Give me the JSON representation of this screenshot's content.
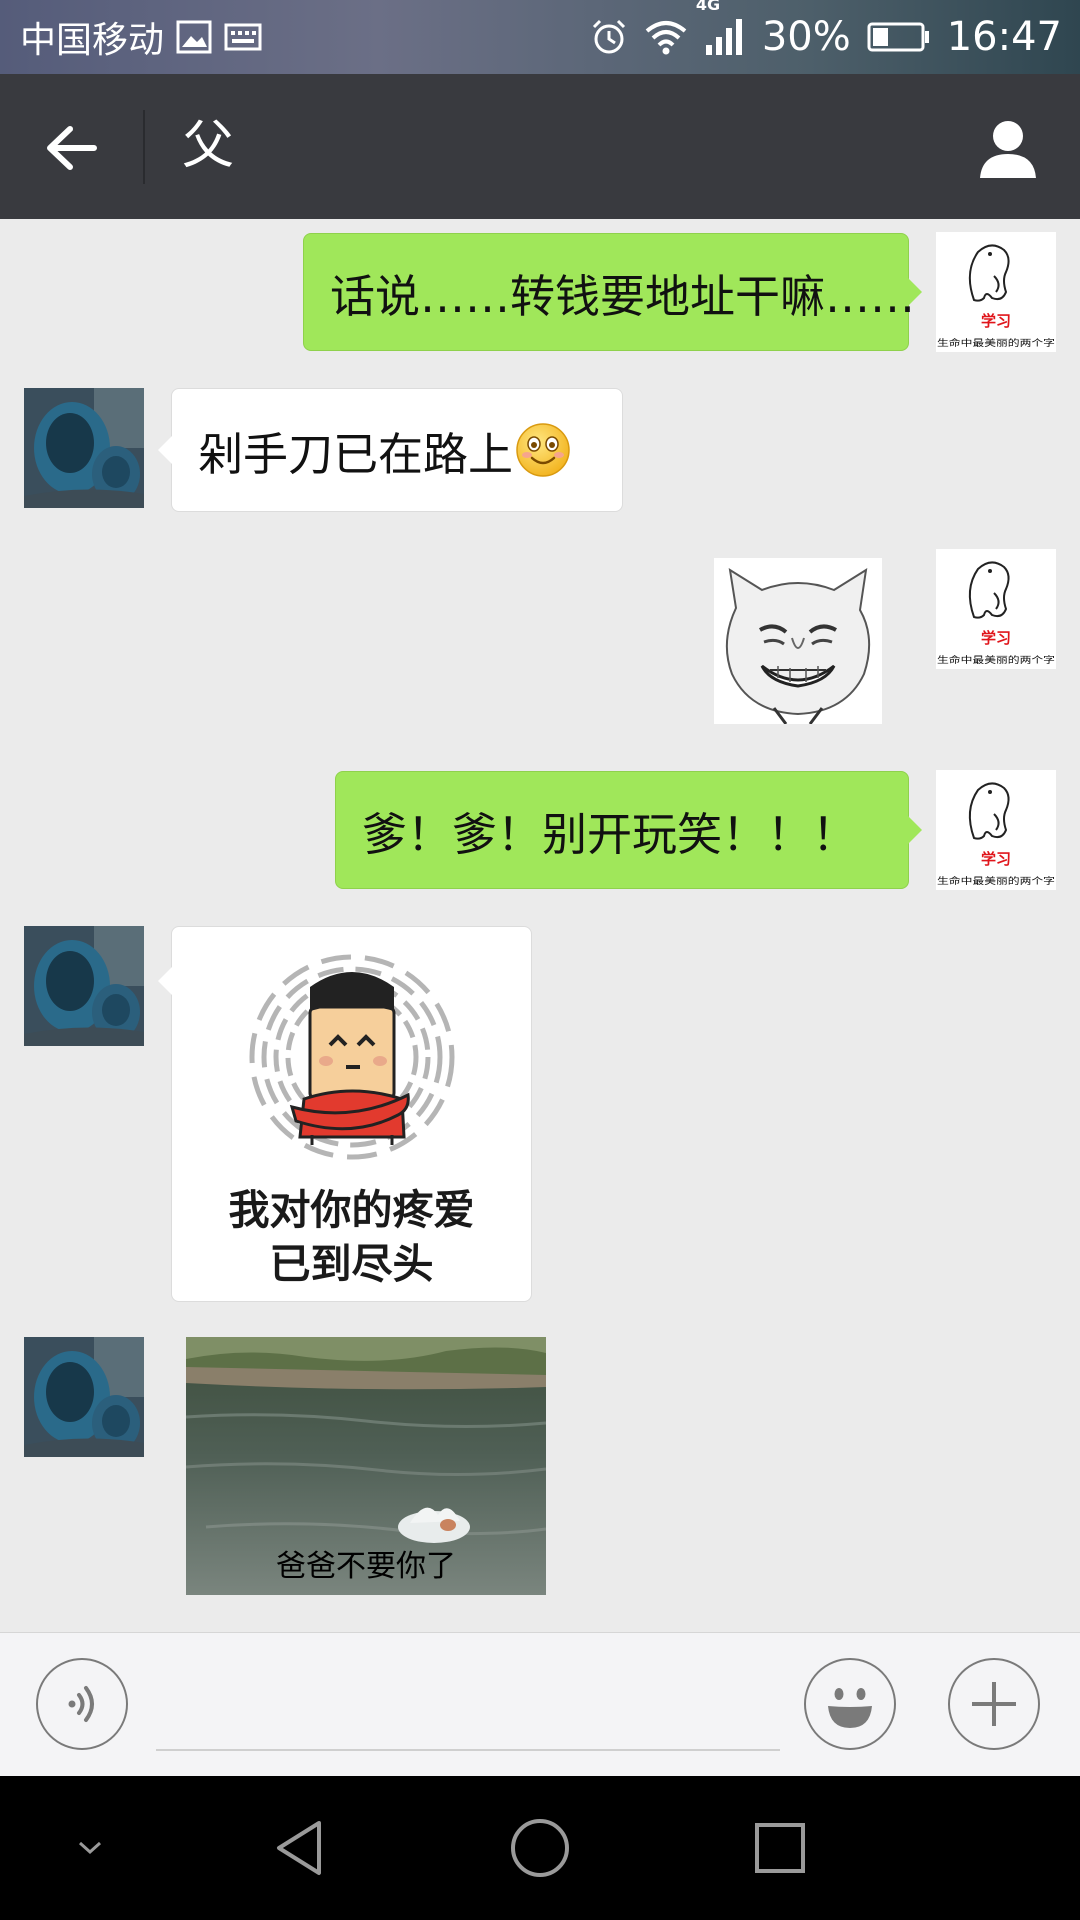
{
  "status_bar": {
    "carrier": "中国移动",
    "network": "4G",
    "battery": "30%",
    "time": "16:47"
  },
  "header": {
    "title": "父"
  },
  "messages": [
    {
      "side": "right",
      "type": "text",
      "text": "话说……转钱要地址干嘛……"
    },
    {
      "side": "left",
      "type": "text",
      "text": "剁手刀已在路上",
      "emoji": "smile-emoji-icon"
    },
    {
      "side": "right",
      "type": "sticker",
      "sticker": "grinning-cat-face-sticker"
    },
    {
      "side": "right",
      "type": "text",
      "text": "爹！爹！别开玩笑！！！"
    },
    {
      "side": "left",
      "type": "sticker",
      "sticker": "cartoon-crossed-arms-sticker",
      "caption_line1": "我对你的疼爱",
      "caption_line2": "已到尽头"
    },
    {
      "side": "left",
      "type": "image",
      "caption": "爸爸不要你了"
    }
  ],
  "my_avatar": {
    "title": "学习",
    "subtitle": "生命中最美丽的两个字"
  },
  "input": {
    "value": "",
    "placeholder": ""
  },
  "colors": {
    "outgoing_bubble": "#a0e75a",
    "incoming_bubble": "#ffffff",
    "title_bar": "#393a3f",
    "chat_background": "#ebebeb"
  }
}
